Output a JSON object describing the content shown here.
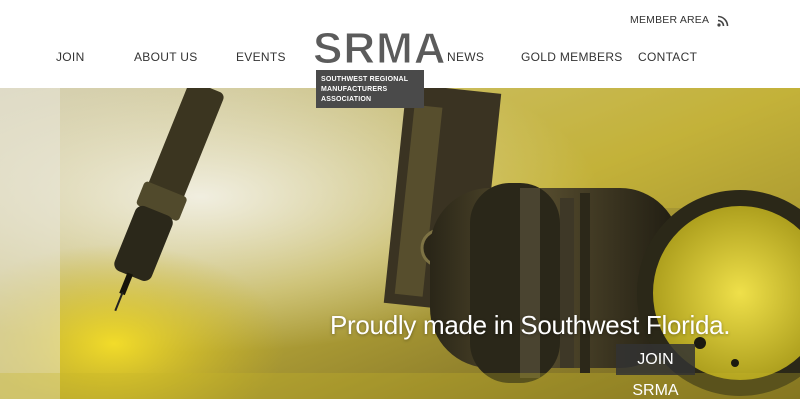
{
  "header": {
    "member_area_label": "MEMBER AREA",
    "rss_icon": "rss-icon",
    "nav": [
      {
        "label": "JOIN"
      },
      {
        "label": "ABOUT US"
      },
      {
        "label": "EVENTS"
      },
      {
        "label": "NEWS"
      },
      {
        "label": "GOLD MEMBERS"
      },
      {
        "label": "CONTACT"
      }
    ]
  },
  "logo": {
    "title": "SRMA",
    "subtitle_line1": "SOUTHWEST REGIONAL",
    "subtitle_line2": "MANUFACTURERS ASSOCIATION"
  },
  "hero": {
    "tagline": "Proudly made in Southwest Florida.",
    "button_label": "JOIN SRMA"
  },
  "colors": {
    "logo_box": "#4a4a4a",
    "accent_yellow": "#e6d41e",
    "text": "#333333"
  }
}
